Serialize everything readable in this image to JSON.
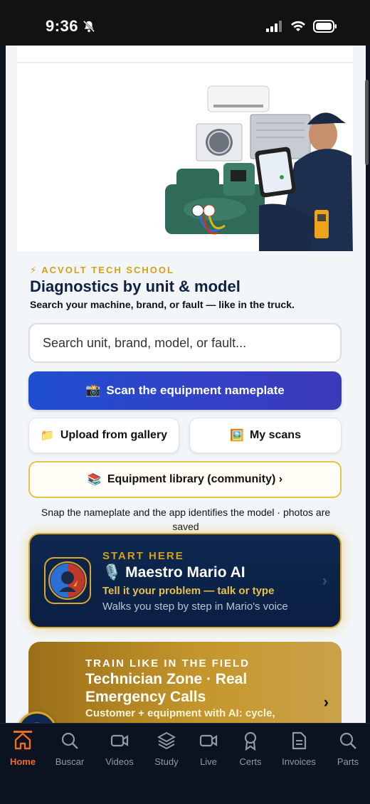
{
  "status": {
    "time": "9:36"
  },
  "header": {
    "eyebrow": "⚡ ACVOLT TECH SCHOOL",
    "title": "Diagnostics by unit & model",
    "subtitle": "Search your machine, brand, or fault — like in the truck."
  },
  "search": {
    "placeholder": "Search unit, brand, model, or fault..."
  },
  "actions": {
    "scan_label": "Scan the equipment nameplate",
    "scan_emoji": "📸",
    "upload_label": "Upload from gallery",
    "upload_emoji": "📁",
    "myscans_label": "My scans",
    "myscans_emoji": "🖼️",
    "library_label": "Equipment library (community) ›",
    "library_emoji": "📚",
    "helper_text": "Snap the nameplate and the app identifies the model · photos are saved"
  },
  "mario_card": {
    "eyebrow": "START HERE",
    "title": "Maestro Mario AI",
    "title_emoji": "🎙️",
    "line1": "Tell it your problem — talk or type",
    "line2": "Walks you step by step in Mario's voice",
    "chevron": "›"
  },
  "tech_card": {
    "eyebrow": "TRAIN LIKE IN THE FIELD",
    "title": "Technician Zone · Real Emergency Calls",
    "line": "Customer + equipment with AI: cycle,",
    "chevron": "›"
  },
  "tabs": [
    {
      "label": "Home",
      "icon": "home-icon"
    },
    {
      "label": "Buscar",
      "icon": "search-icon"
    },
    {
      "label": "Videos",
      "icon": "video-icon"
    },
    {
      "label": "Study",
      "icon": "layers-icon"
    },
    {
      "label": "Live",
      "icon": "live-video-icon"
    },
    {
      "label": "Certs",
      "icon": "certificate-icon"
    },
    {
      "label": "Invoices",
      "icon": "invoice-icon"
    },
    {
      "label": "Parts",
      "icon": "search-icon"
    }
  ],
  "colors": {
    "accent": "#ef6b1f",
    "gold": "#d4a019",
    "navy": "#0f2142",
    "primary": "#1e4fd0"
  }
}
